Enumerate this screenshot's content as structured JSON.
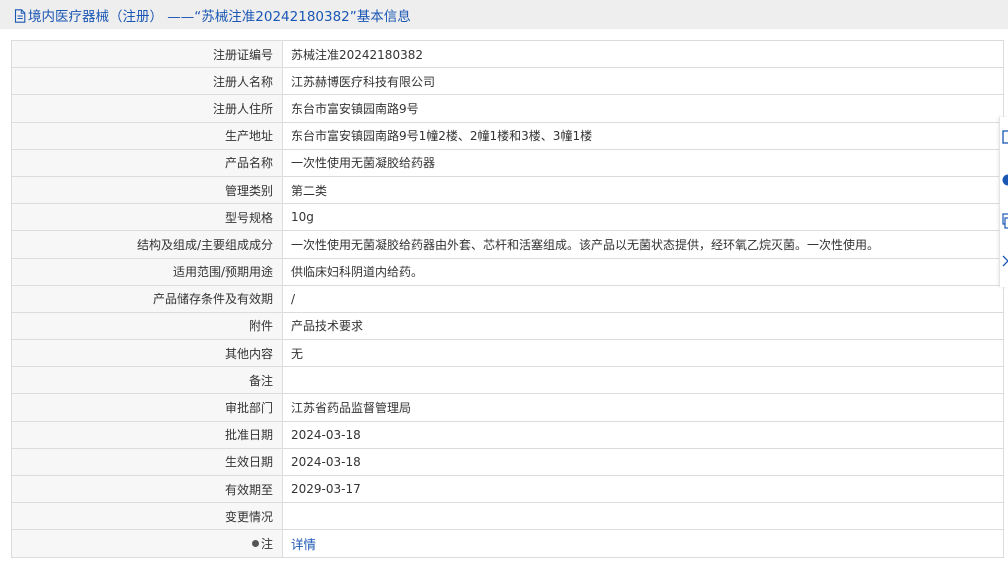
{
  "header": {
    "icon": "document-icon",
    "title": "境内医疗器械（注册） ——“苏械注准20242180382”基本信息"
  },
  "rows": [
    {
      "label": "注册证编号",
      "value": "苏械注准20242180382"
    },
    {
      "label": "注册人名称",
      "value": "江苏赫博医疗科技有限公司"
    },
    {
      "label": "注册人住所",
      "value": "东台市富安镇园南路9号"
    },
    {
      "label": "生产地址",
      "value": "东台市富安镇园南路9号1幢2楼、2幢1楼和3楼、3幢1楼"
    },
    {
      "label": "产品名称",
      "value": "一次性使用无菌凝胶给药器"
    },
    {
      "label": "管理类别",
      "value": "第二类"
    },
    {
      "label": "型号规格",
      "value": "10g"
    },
    {
      "label": "结构及组成/主要组成成分",
      "value": "一次性使用无菌凝胶给药器由外套、芯杆和活塞组成。该产品以无菌状态提供，经环氧乙烷灭菌。一次性使用。"
    },
    {
      "label": "适用范围/预期用途",
      "value": "供临床妇科阴道内给药。"
    },
    {
      "label": "产品储存条件及有效期",
      "value": "/"
    },
    {
      "label": "附件",
      "value": "产品技术要求"
    },
    {
      "label": "其他内容",
      "value": "无"
    },
    {
      "label": "备注",
      "value": ""
    },
    {
      "label": "审批部门",
      "value": "江苏省药品监督管理局"
    },
    {
      "label": "批准日期",
      "value": "2024-03-18"
    },
    {
      "label": "生效日期",
      "value": "2024-03-18"
    },
    {
      "label": "有效期至",
      "value": "2029-03-17"
    },
    {
      "label": "变更情况",
      "value": ""
    }
  ],
  "note_row": {
    "label": "注",
    "icon": "note-dot-icon",
    "link_text": "详情"
  },
  "colors": {
    "accent": "#1a57b4",
    "header_bg": "#eeeeee",
    "label_bg": "#f7f7f7",
    "border": "#dcdcdc",
    "text": "#333333"
  },
  "side_toolbar": {
    "icons": [
      "square-icon",
      "circle-icon",
      "copy-icon",
      "expand-icon"
    ]
  }
}
